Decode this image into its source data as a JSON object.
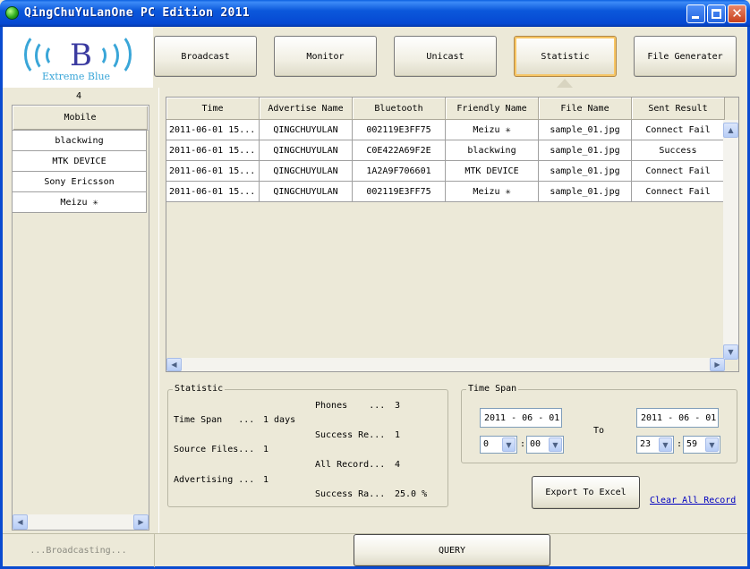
{
  "window": {
    "title": "QingChuYuLanOne PC Edition 2011"
  },
  "logo": {
    "letter": "B",
    "subtitle": "Extreme Blue"
  },
  "tabs": [
    {
      "label": "Broadcast"
    },
    {
      "label": "Monitor"
    },
    {
      "label": "Unicast"
    },
    {
      "label": "Statistic",
      "active": true
    },
    {
      "label": "File Generater"
    }
  ],
  "devices": {
    "count": "4",
    "header": "Mobile",
    "items": [
      "blackwing",
      "MTK DEVICE",
      "Sony Ericsson",
      "Meizu ✳"
    ]
  },
  "grid": {
    "columns": [
      "Time",
      "Advertise Name",
      "Bluetooth",
      "Friendly Name",
      "File Name",
      "Sent Result"
    ],
    "rows": [
      [
        "2011-06-01 15...",
        "QINGCHUYULAN",
        "002119E3FF75",
        "Meizu ✳",
        "sample_01.jpg",
        "Connect Fail"
      ],
      [
        "2011-06-01 15...",
        "QINGCHUYULAN",
        "C0E422A69F2E",
        "blackwing",
        "sample_01.jpg",
        "Success"
      ],
      [
        "2011-06-01 15...",
        "QINGCHUYULAN",
        "1A2A9F706601",
        "MTK DEVICE",
        "sample_01.jpg",
        "Connect Fail"
      ],
      [
        "2011-06-01 15...",
        "QINGCHUYULAN",
        "002119E3FF75",
        "Meizu ✳",
        "sample_01.jpg",
        "Connect Fail"
      ]
    ]
  },
  "statistic": {
    "title": "Statistic",
    "time_span_label": "Time Span   ...",
    "time_span_value": "1 days",
    "source_files_label": "Source Files...",
    "source_files_value": "1",
    "advertising_label": "Advertising ...",
    "advertising_value": "1",
    "phones_label": "Phones    ...",
    "phones_value": "3",
    "success_re_label": "Success Re...",
    "success_re_value": "1",
    "all_record_label": "All Record...",
    "all_record_value": "4",
    "success_ra_label": "Success Ra...",
    "success_ra_value": "25.0 %"
  },
  "time_span": {
    "title": "Time Span",
    "from_date": "2011 - 06 - 01",
    "to_date": "2011 - 06 - 01",
    "to_label": "To",
    "from_hour": "0",
    "from_minute": "00",
    "to_hour": "23",
    "to_minute": "59",
    "separator": ":"
  },
  "actions": {
    "export_label": "Export To Excel",
    "clear_label": "Clear All Record",
    "query_label": "QUERY"
  },
  "status": {
    "text": "...Broadcasting..."
  },
  "colors": {
    "titlebar": "#0a5fe0",
    "active_tab_border": "#f7c563",
    "link": "#0000c0"
  }
}
